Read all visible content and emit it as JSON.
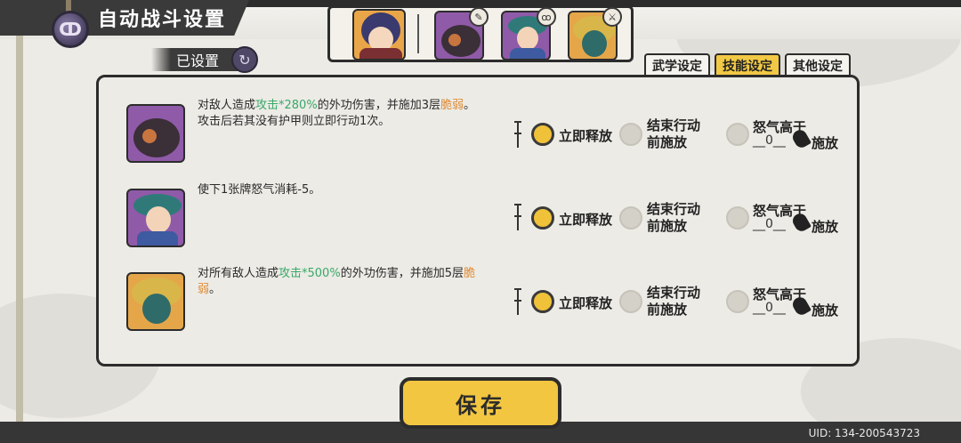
{
  "header": {
    "title": "自动战斗设置",
    "title_icon": "swirl-emblem-icon"
  },
  "status": {
    "label": "已设置",
    "icon": "refresh-swirl-icon"
  },
  "tabs": [
    {
      "label": "武学设定",
      "active": false
    },
    {
      "label": "技能设定",
      "active": true
    },
    {
      "label": "其他设定",
      "active": false
    }
  ],
  "skills": [
    {
      "desc_line1_pre": "对敌人造成",
      "desc_line1_hl": "攻击*280%",
      "desc_line1_mid": "的外功伤害，并施加3层",
      "desc_line1_hl2": "脆弱",
      "desc_line1_post": "。",
      "desc_line2": "攻击后若其没有护甲则立即行动1次。",
      "selected": "immediate"
    },
    {
      "desc_line1_pre": "使下1张牌怒气消耗-5。",
      "desc_line1_hl": "",
      "desc_line1_mid": "",
      "desc_line1_hl2": "",
      "desc_line1_post": "",
      "desc_line2": "",
      "selected": "immediate"
    },
    {
      "desc_line1_pre": "对所有敌人造成",
      "desc_line1_hl": "攻击*500%",
      "desc_line1_mid": "的外功伤害，并施加5层",
      "desc_line1_hl2": "脆",
      "desc_line1_post": "",
      "desc_line2_hl": "弱",
      "desc_line2": "。",
      "selected": "immediate"
    }
  ],
  "options": {
    "immediate": "立即释放",
    "end_turn_line1": "结束行动",
    "end_turn_line2": "前施放",
    "rage_line1": "怒气高于",
    "rage_value": "0",
    "rage_suffix": "施放"
  },
  "save_label": "保存",
  "uid": "UID:  134-200543723",
  "colors": {
    "accent_yellow": "#f2c640",
    "highlight_green": "#3aa868",
    "highlight_orange": "#e08a32"
  }
}
